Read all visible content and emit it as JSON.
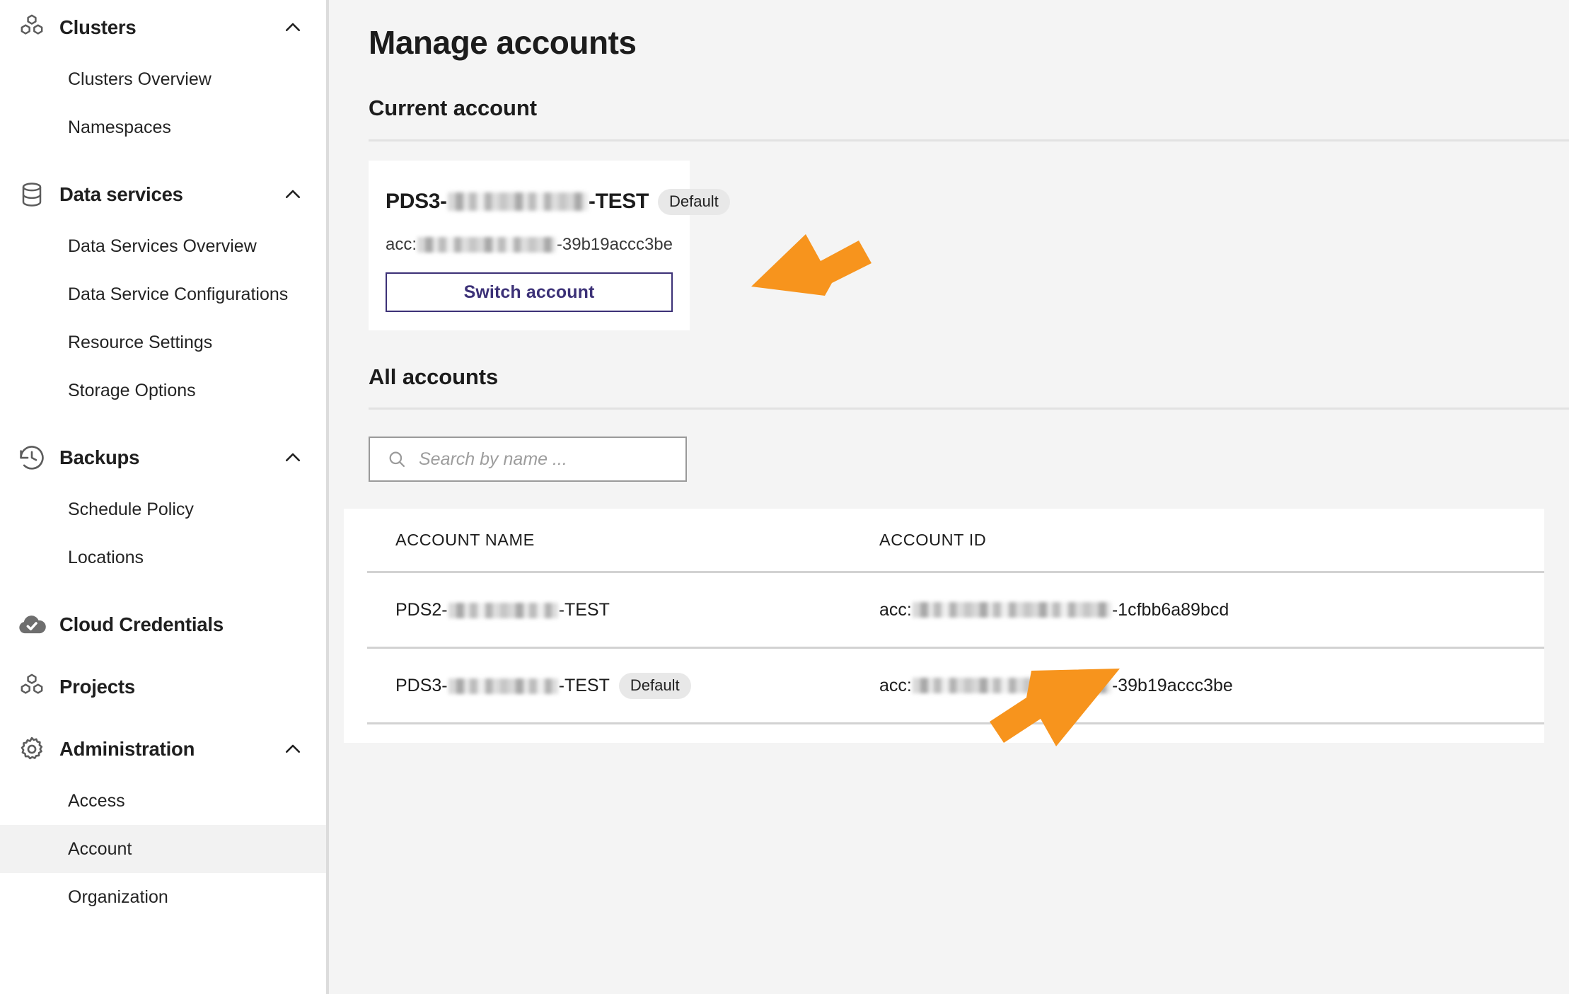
{
  "sidebar": {
    "groups": [
      {
        "label": "Clusters",
        "icon": "cubes-icon",
        "expanded": true,
        "items": [
          {
            "label": "Clusters Overview",
            "active": false
          },
          {
            "label": "Namespaces",
            "active": false
          }
        ]
      },
      {
        "label": "Data services",
        "icon": "database-icon",
        "expanded": true,
        "items": [
          {
            "label": "Data Services Overview",
            "active": false
          },
          {
            "label": "Data Service Configurations",
            "active": false
          },
          {
            "label": "Resource Settings",
            "active": false
          },
          {
            "label": "Storage Options",
            "active": false
          }
        ]
      },
      {
        "label": "Backups",
        "icon": "history-clock-icon",
        "expanded": true,
        "items": [
          {
            "label": "Schedule Policy",
            "active": false
          },
          {
            "label": "Locations",
            "active": false
          }
        ]
      },
      {
        "label": "Cloud Credentials",
        "icon": "cloud-check-icon",
        "expanded": false,
        "items": []
      },
      {
        "label": "Projects",
        "icon": "cubes-icon",
        "expanded": false,
        "items": []
      },
      {
        "label": "Administration",
        "icon": "gear-icon",
        "expanded": true,
        "items": [
          {
            "label": "Access",
            "active": false
          },
          {
            "label": "Account",
            "active": true
          },
          {
            "label": "Organization",
            "active": false
          }
        ]
      }
    ]
  },
  "main": {
    "page_title": "Manage accounts",
    "current_account": {
      "section_title": "Current account",
      "name_prefix": "PDS3-",
      "name_suffix": "-TEST",
      "badge": "Default",
      "id_prefix": "acc:",
      "id_suffix": "-39b19accc3be",
      "switch_label": "Switch account"
    },
    "all_accounts": {
      "section_title": "All accounts",
      "search_placeholder": "Search by name ...",
      "search_value": "",
      "columns": [
        "ACCOUNT NAME",
        "ACCOUNT ID"
      ],
      "rows": [
        {
          "name_prefix": "PDS2-",
          "name_suffix": "-TEST",
          "badge": "",
          "id_prefix": "acc:",
          "id_suffix": "-1cfbb6a89bcd"
        },
        {
          "name_prefix": "PDS3-",
          "name_suffix": "-TEST",
          "badge": "Default",
          "id_prefix": "acc:",
          "id_suffix": "-39b19accc3be"
        }
      ]
    }
  },
  "annotations": {
    "arrow_color": "#f7941d",
    "arrows": [
      {
        "name": "arrow-pointing-current-account-id",
        "direction": "down-left"
      },
      {
        "name": "arrow-pointing-table-account-id",
        "direction": "up-right"
      }
    ]
  },
  "colors": {
    "accent_purple": "#3c3177",
    "page_background": "#f4f4f4",
    "panel_background": "#ffffff",
    "badge_background": "#e8e8e8",
    "annotation_orange": "#f7941d"
  }
}
